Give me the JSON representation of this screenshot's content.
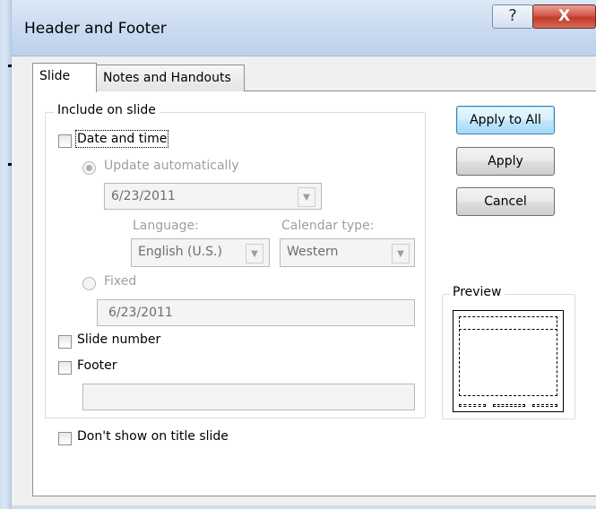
{
  "window": {
    "title": "Header and Footer",
    "help_glyph": "?",
    "close_glyph": "X"
  },
  "tabs": [
    {
      "label": "Slide",
      "active": true
    },
    {
      "label": "Notes and Handouts",
      "active": false
    }
  ],
  "include_group": {
    "label": "Include on slide",
    "date_time": {
      "label": "Date and time",
      "checked": false
    },
    "update_auto": {
      "label": "Update automatically",
      "selected": true,
      "enabled": false
    },
    "date_value": "6/23/2011",
    "language_label": "Language:",
    "language_value": "English (U.S.)",
    "calendar_label": "Calendar type:",
    "calendar_value": "Western",
    "fixed": {
      "label": "Fixed",
      "selected": false,
      "enabled": false
    },
    "fixed_value": "6/23/2011",
    "slide_number": {
      "label": "Slide number",
      "checked": false
    },
    "footer": {
      "label": "Footer",
      "checked": false
    },
    "footer_value": ""
  },
  "dont_show_title": {
    "label": "Don't show on title slide",
    "checked": false
  },
  "buttons": {
    "apply_all": "Apply to All",
    "apply": "Apply",
    "cancel": "Cancel"
  },
  "preview": {
    "label": "Preview"
  },
  "colors": {
    "default_button_border": "#3c7fb1",
    "close_button": "#c23b2b"
  }
}
